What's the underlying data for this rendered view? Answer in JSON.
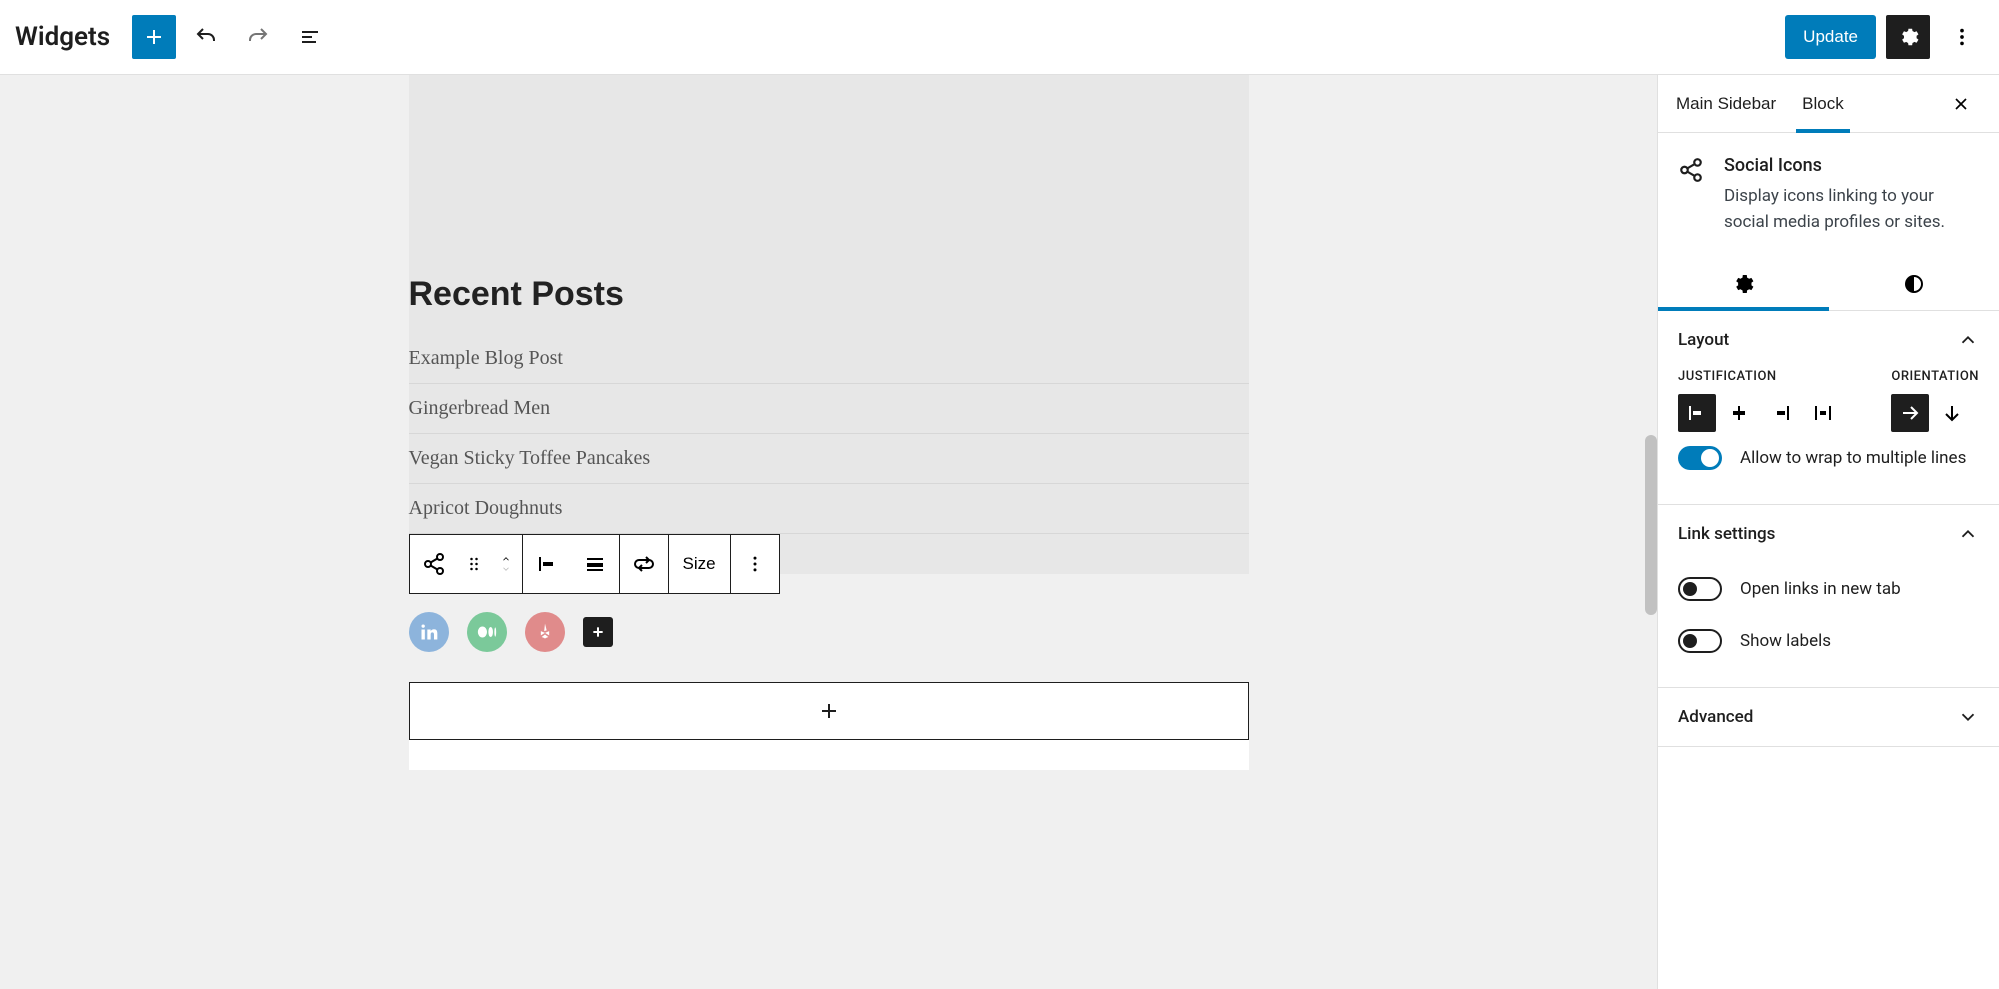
{
  "topbar": {
    "title": "Widgets",
    "update_label": "Update"
  },
  "canvas": {
    "recent_posts_heading": "Recent Posts",
    "posts": [
      "Example Blog Post",
      "Gingerbread Men",
      "Vegan Sticky Toffee Pancakes",
      "Apricot Doughnuts"
    ],
    "toolbar": {
      "size_label": "Size"
    },
    "social_icons": [
      {
        "name": "linkedin"
      },
      {
        "name": "medium"
      },
      {
        "name": "yelp"
      }
    ]
  },
  "sidebar": {
    "tabs": {
      "document": "Main Sidebar",
      "block": "Block"
    },
    "block_card": {
      "title": "Social Icons",
      "description": "Display icons linking to your social media profiles or sites."
    },
    "layout": {
      "panel_title": "Layout",
      "justification_label": "JUSTIFICATION",
      "orientation_label": "ORIENTATION",
      "wrap_label": "Allow to wrap to multiple lines",
      "wrap_on": true
    },
    "link_settings": {
      "panel_title": "Link settings",
      "new_tab_label": "Open links in new tab",
      "new_tab_on": false,
      "show_labels_label": "Show labels",
      "show_labels_on": false
    },
    "advanced": {
      "panel_title": "Advanced"
    }
  }
}
